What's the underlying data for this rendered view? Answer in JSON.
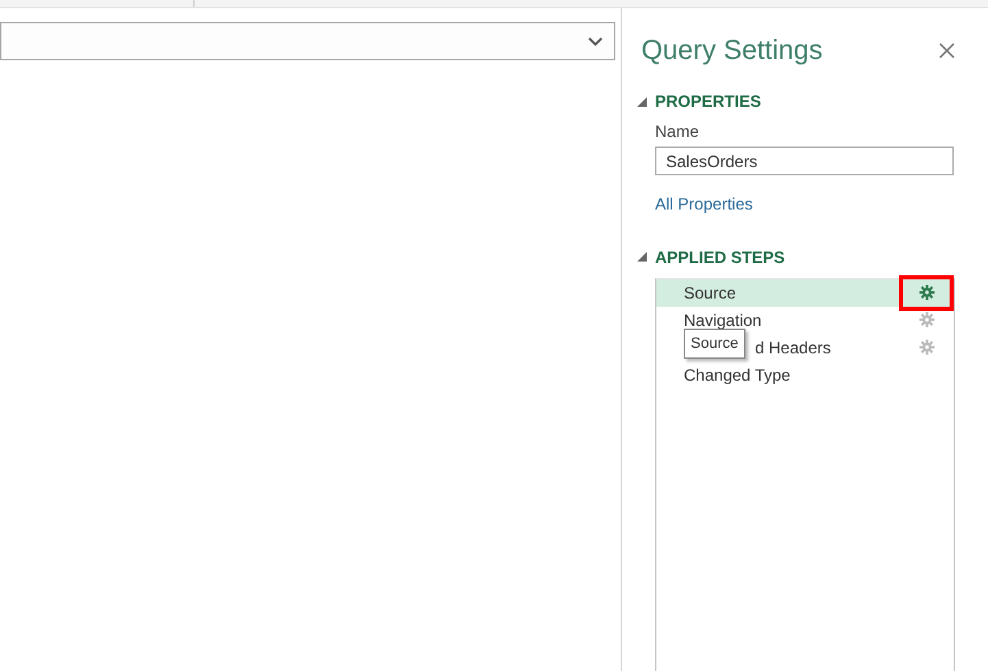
{
  "panel": {
    "title": "Query Settings"
  },
  "properties": {
    "heading": "PROPERTIES",
    "expanded": true,
    "name_label": "Name",
    "name_value": "SalesOrders",
    "link": "All Properties"
  },
  "applied_steps": {
    "heading": "APPLIED STEPS",
    "expanded": true,
    "steps": [
      {
        "label": "Source",
        "selected": true,
        "has_settings": true,
        "highlighted": true
      },
      {
        "label": "Navigation",
        "selected": false,
        "has_settings": true,
        "highlighted": false
      },
      {
        "label": "d Headers",
        "selected": false,
        "has_settings": true,
        "highlighted": false
      },
      {
        "label": "Changed Type",
        "selected": false,
        "has_settings": false,
        "highlighted": false
      }
    ]
  },
  "tooltip": {
    "text": "Source"
  }
}
